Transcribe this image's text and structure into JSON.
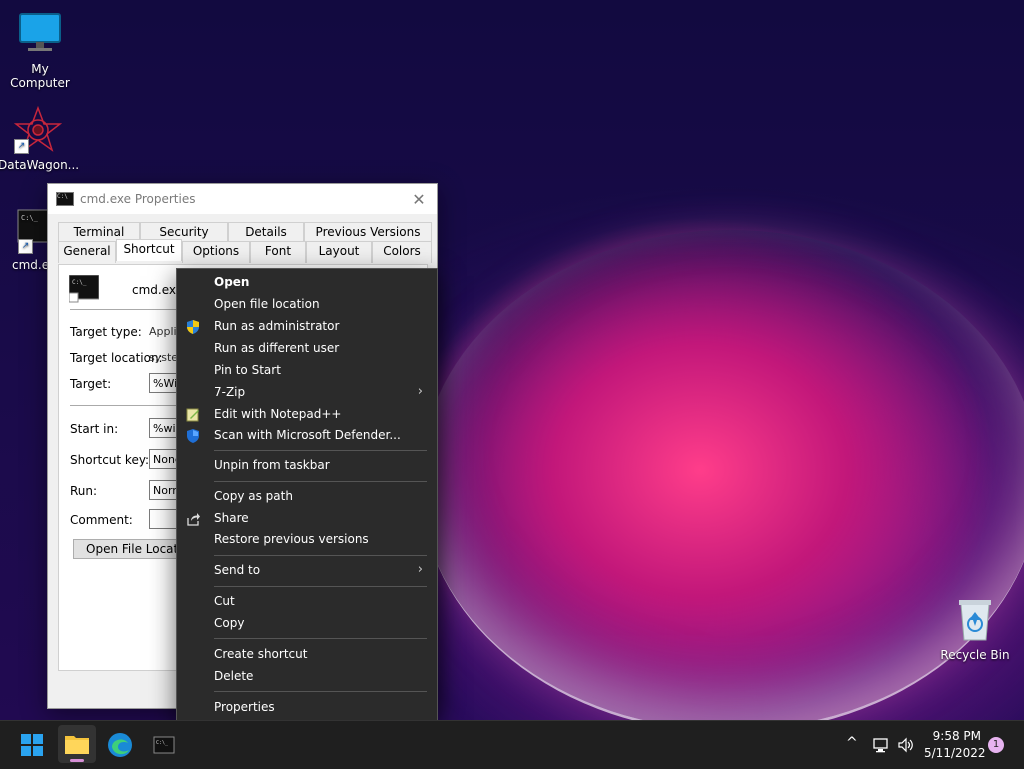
{
  "desktop": {
    "icons": [
      {
        "label": "My Computer"
      },
      {
        "label": "DataWagon..."
      },
      {
        "label": "cmd.e"
      },
      {
        "label": "Recycle Bin"
      }
    ]
  },
  "properties_window": {
    "title": "cmd.exe Properties",
    "tabs_row1": [
      "Terminal",
      "Security",
      "Details",
      "Previous Versions"
    ],
    "tabs_row2": [
      "General",
      "Shortcut",
      "Options",
      "Font",
      "Layout",
      "Colors"
    ],
    "active_tab": "Shortcut",
    "file_name": "cmd.exe",
    "fields": {
      "target_type_label": "Target type:",
      "target_type_value": "Applic",
      "target_location_label": "Target location:",
      "target_location_value": "system",
      "target_label": "Target:",
      "target_value": "%Win",
      "start_in_label": "Start in:",
      "start_in_value": "%wind",
      "shortcut_key_label": "Shortcut key:",
      "shortcut_key_value": "None",
      "run_label": "Run:",
      "run_value": "Norm",
      "comment_label": "Comment:",
      "comment_value": ""
    },
    "open_file_location_button": "Open File Location"
  },
  "context_menu": {
    "items": [
      {
        "label": "Open",
        "bold": true
      },
      {
        "label": "Open file location"
      },
      {
        "label": "Run as administrator",
        "icon": "shield-icon"
      },
      {
        "label": "Run as different user"
      },
      {
        "label": "Pin to Start"
      },
      {
        "label": "7-Zip",
        "submenu": true
      },
      {
        "label": "Edit with Notepad++",
        "icon": "notepad-icon"
      },
      {
        "label": "Scan with Microsoft Defender...",
        "icon": "defender-icon"
      },
      {
        "label": "Unpin from taskbar"
      },
      {
        "label": "Copy as path"
      },
      {
        "label": "Share",
        "icon": "share-icon"
      },
      {
        "label": "Restore previous versions"
      },
      {
        "label": "Send to",
        "submenu": true
      },
      {
        "label": "Cut"
      },
      {
        "label": "Copy"
      },
      {
        "label": "Create shortcut"
      },
      {
        "label": "Delete"
      },
      {
        "label": "Properties"
      }
    ],
    "arrow_glyph": "›"
  },
  "taskbar": {
    "apps": [
      "start-button",
      "file-explorer",
      "edge",
      "cmd"
    ],
    "tray_arrow": "^",
    "time": "9:58 PM",
    "date": "5/11/2022",
    "notification_count": "1"
  },
  "colors": {
    "menu_bg": "#2b2b2b",
    "taskbar_bg": "#1f1f1f",
    "accent_blue": "#0078d4",
    "shield_yellow": "#f2c811"
  }
}
